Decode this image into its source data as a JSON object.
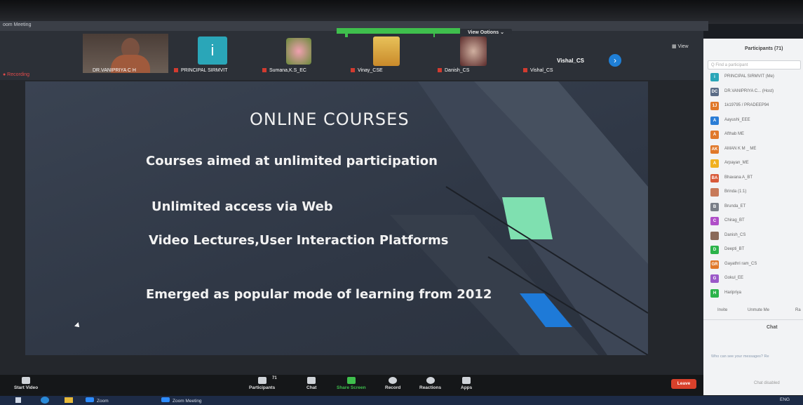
{
  "window": {
    "title": "oom Meeting"
  },
  "top": {
    "view_options": "View Options ⌄",
    "recording": "● Recording",
    "view": "▦ View"
  },
  "tiles": [
    {
      "name": "DR.VANIPRIYA C H"
    },
    {
      "name": "PRINCIPAL SIRMVIT",
      "letter": "i"
    },
    {
      "name": "Sumana,K.S_EC"
    },
    {
      "name": "Vinay_CSE"
    },
    {
      "name": "Danish_CS"
    },
    {
      "name": "Vishal_CS",
      "center_label": "Vishal_CS"
    }
  ],
  "slide": {
    "title": "ONLINE COURSES",
    "bullets": [
      "Courses aimed at unlimited participation",
      "Unlimited access via Web",
      "Video Lectures,User Interaction Platforms",
      "Emerged as popular mode of learning from 2012"
    ]
  },
  "controls": {
    "start_video": "Start Video",
    "participants": "Participants",
    "participants_count": "71",
    "chat": "Chat",
    "share_screen": "Share Screen",
    "record": "Record",
    "reactions": "Reactions",
    "apps": "Apps",
    "leave": "Leave"
  },
  "panel": {
    "title": "Participants (71)",
    "search_placeholder": "Q Find a participant",
    "participants": [
      {
        "initials": "i",
        "name": "PRINCIPAL SIRMVIT (Me)",
        "color": "#2aa6b8"
      },
      {
        "initials": "DC",
        "name": "DR.VANIPRIYA C... (Host)",
        "color": "#5a6b86"
      },
      {
        "initials": "1J",
        "name": "1k19795 / PRADEEP94",
        "color": "#e0782a"
      },
      {
        "initials": "A",
        "name": "Aayushi_EEE",
        "color": "#2a7dd6"
      },
      {
        "initials": "A",
        "name": "Afthab ME",
        "color": "#e0782a"
      },
      {
        "initials": "AK",
        "name": "AMAN K M _ ME",
        "color": "#e0782a"
      },
      {
        "initials": "A",
        "name": "Arpayan_ME",
        "color": "#f0b020"
      },
      {
        "initials": "BA",
        "name": "Bhavana A_BT",
        "color": "#d85a3a"
      },
      {
        "initials": "",
        "name": "Brinda (1:1)",
        "color": "#c77a5a"
      },
      {
        "initials": "B",
        "name": "Brunda_ET",
        "color": "#7a7f88"
      },
      {
        "initials": "C",
        "name": "Chirag_BT",
        "color": "#b04fc8"
      },
      {
        "initials": "",
        "name": "Danish_CS",
        "color": "#8a6a5a"
      },
      {
        "initials": "D",
        "name": "Deepti_BT",
        "color": "#2bb34a"
      },
      {
        "initials": "GR",
        "name": "Gayathri ram_CS",
        "color": "#e0782a"
      },
      {
        "initials": "G",
        "name": "Gokul_EE",
        "color": "#9b59c8"
      },
      {
        "initials": "H",
        "name": "Haripriya",
        "color": "#2bb34a"
      }
    ],
    "invite": "Invite",
    "unmute_me": "Unmute Me",
    "raise": "Ra",
    "chat_title": "Chat",
    "chat_info": "Who can see your messages? Re",
    "chat_disabled": "Chat disabled"
  },
  "taskbar": {
    "zoom": "Zoom",
    "zoom_meeting": "Zoom Meeting",
    "lang": "ENG"
  }
}
